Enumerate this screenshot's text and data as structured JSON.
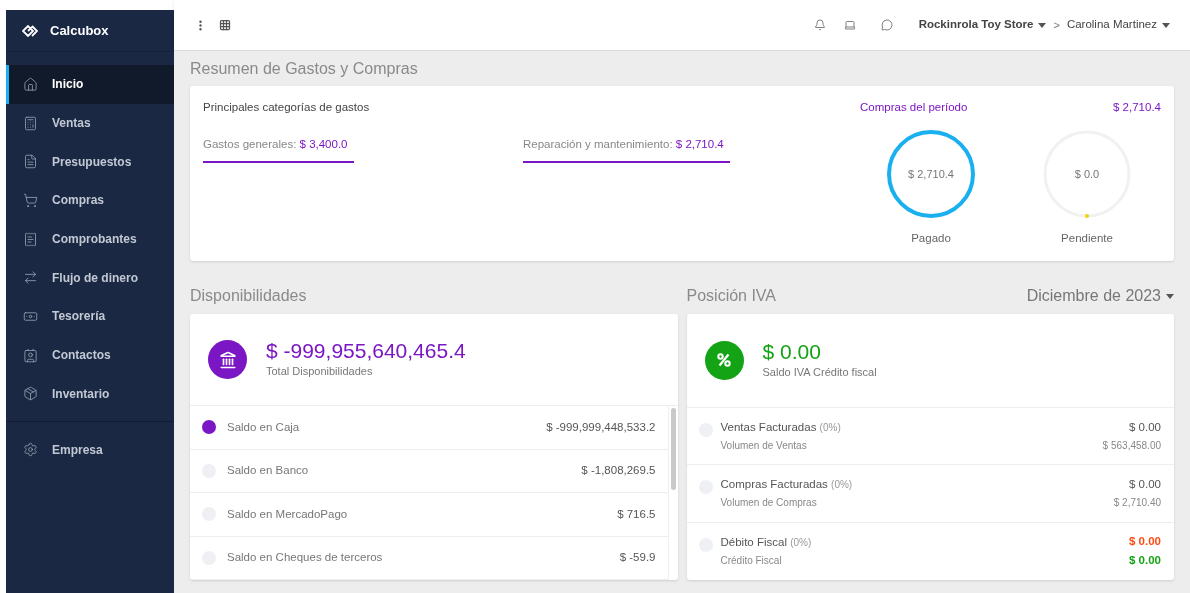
{
  "sidebar": {
    "brand": "Calcubox",
    "items": [
      {
        "label": "Inicio",
        "selected": true
      },
      {
        "label": "Ventas",
        "selected": false
      },
      {
        "label": "Presupuestos",
        "selected": false
      },
      {
        "label": "Compras",
        "selected": false
      },
      {
        "label": "Comprobantes",
        "selected": false
      },
      {
        "label": "Flujo de dinero",
        "selected": false
      },
      {
        "label": "Tesorería",
        "selected": false
      },
      {
        "label": "Contactos",
        "selected": false
      },
      {
        "label": "Inventario",
        "selected": false
      }
    ],
    "footer_items": [
      {
        "label": "Empresa",
        "selected": false
      }
    ]
  },
  "topbar": {
    "store": "Rockinrola Toy Store",
    "separator": ">",
    "user": "Carolina Martinez"
  },
  "summary": {
    "heading": "Resumen de Gastos y Compras",
    "categories_title": "Principales categorías de gastos",
    "categories": [
      {
        "label": "Gastos generales:",
        "amount": "$ 3,400.0"
      },
      {
        "label": "Reparación y mantenimiento:",
        "amount": "$ 2,710.4"
      }
    ],
    "purchases_title": "Compras del período",
    "purchases_total": "$ 2,710.4",
    "rings": [
      {
        "kind": "full",
        "value": "$ 2,710.4",
        "label": "Pagado"
      },
      {
        "kind": "empty",
        "value": "$ 0.0",
        "label": "Pendiente"
      }
    ]
  },
  "availability": {
    "heading": "Disponibilidades",
    "total": "$ -999,955,640,465.4",
    "total_label": "Total Disponibilidades",
    "rows": [
      {
        "label": "Saldo en Caja",
        "amount": "$ -999,999,448,533.2",
        "color": "#7b16c4"
      },
      {
        "label": "Saldo en Banco",
        "amount": "$ -1,808,269.5",
        "color": "#eef0f3"
      },
      {
        "label": "Saldo en MercadoPago",
        "amount": "$ 716.5",
        "color": "#eef0f3"
      },
      {
        "label": "Saldo en Cheques de terceros",
        "amount": "$ -59.9",
        "color": "#eef0f3"
      }
    ]
  },
  "iva": {
    "heading": "Posición IVA",
    "period": "Diciembre de 2023",
    "total": "$ 0.00",
    "total_label": "Saldo IVA Crédito fiscal",
    "rows": [
      {
        "kind": "plain",
        "title": "Ventas Facturadas",
        "percent": "(0%)",
        "subtitle": "Volumen de Ventas",
        "amount": "$ 0.00",
        "sub_amount": "$ 563,458.00"
      },
      {
        "kind": "plain",
        "title": "Compras Facturadas",
        "percent": "(0%)",
        "subtitle": "Volumen de Compras",
        "amount": "$ 0.00",
        "sub_amount": "$ 2,710.40"
      },
      {
        "kind": "balance",
        "title": "Débito Fiscal",
        "percent": "(0%)",
        "subtitle": "Crédito Fiscal",
        "amount": "$ 0.00",
        "sub_amount": "$ 0.00"
      }
    ]
  }
}
